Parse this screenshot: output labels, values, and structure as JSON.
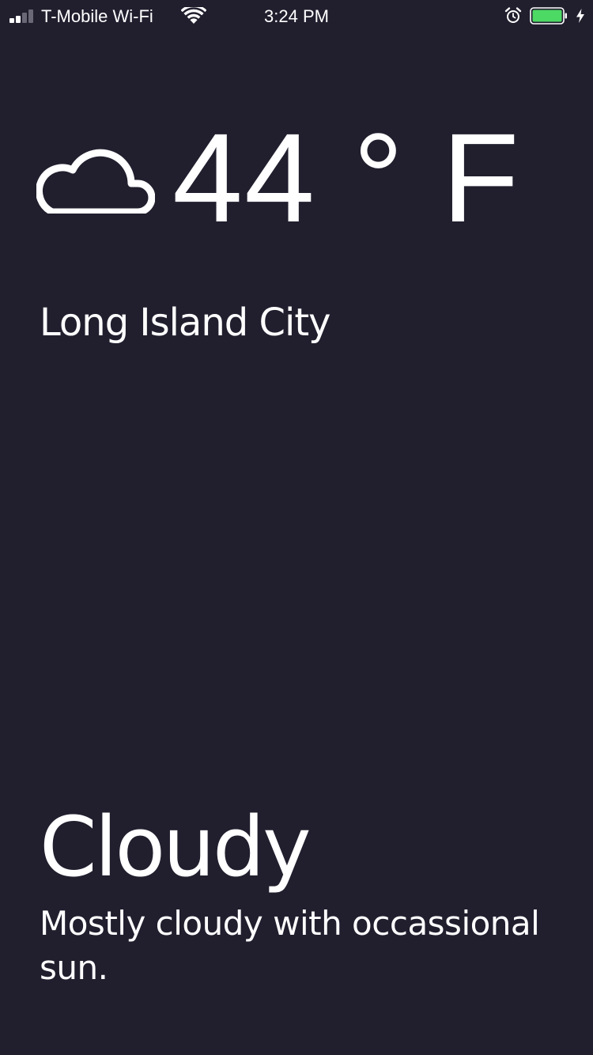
{
  "status_bar": {
    "carrier": "T-Mobile Wi-Fi",
    "time": "3:24 PM",
    "signal_bars_filled": 2,
    "signal_bars_total": 4,
    "battery_color": "#4cd964",
    "battery_level": 1.0,
    "icons": [
      "wifi-icon",
      "alarm-icon",
      "battery-icon",
      "charging-bolt-icon"
    ]
  },
  "weather": {
    "icon": "cloud-icon",
    "temperature": "44",
    "unit": "° F",
    "temperature_display": "44 ° F",
    "city": "Long Island City",
    "condition": "Cloudy",
    "description": "Mostly cloudy with occassional sun."
  },
  "colors": {
    "background": "#211f2e",
    "text": "#ffffff"
  }
}
